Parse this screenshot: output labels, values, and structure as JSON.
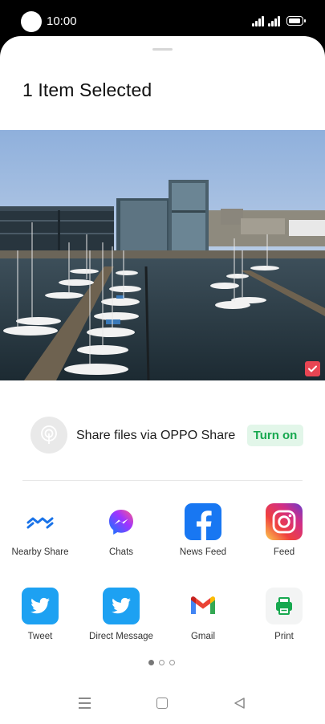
{
  "status_bar": {
    "time": "10:00"
  },
  "header": {
    "title": "1 Item Selected"
  },
  "oppo_share": {
    "text": "Share files via OPPO Share",
    "button": "Turn on"
  },
  "apps": [
    {
      "label": "Nearby Share",
      "icon": "nearby-share-icon"
    },
    {
      "label": "Chats",
      "icon": "messenger-icon"
    },
    {
      "label": "News Feed",
      "icon": "facebook-icon"
    },
    {
      "label": "Feed",
      "icon": "instagram-icon"
    },
    {
      "label": "Tweet",
      "icon": "twitter-icon"
    },
    {
      "label": "Direct Message",
      "icon": "twitter-icon"
    },
    {
      "label": "Gmail",
      "icon": "gmail-icon"
    },
    {
      "label": "Print",
      "icon": "print-icon"
    }
  ],
  "pagination": {
    "pages": 3,
    "current": 1
  },
  "colors": {
    "accent_green": "#17a84f",
    "selected_badge": "#e84553",
    "twitter": "#1da1f2",
    "facebook": "#1877f2"
  }
}
